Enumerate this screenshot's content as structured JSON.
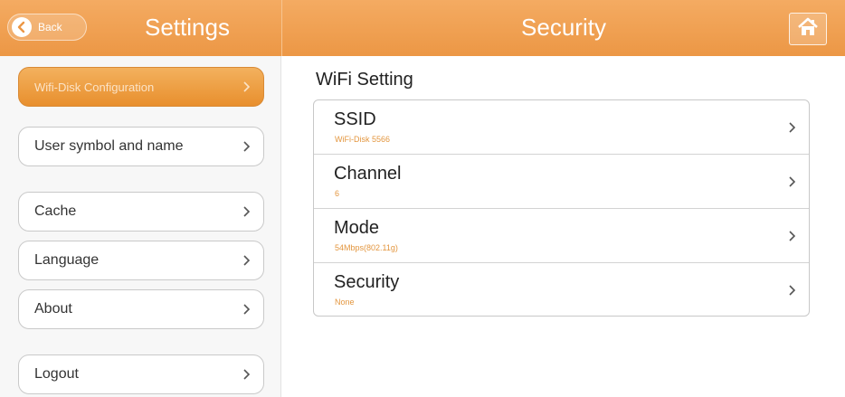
{
  "header": {
    "back_label": "Back",
    "settings_title": "Settings",
    "page_title": "Security",
    "icons": {
      "back": "back-arrow-icon",
      "home": "home-icon"
    }
  },
  "sidebar": {
    "items": [
      {
        "label": "Wifi-Disk Configuration",
        "active": true
      },
      {
        "label": "User symbol and name",
        "active": false
      },
      {
        "label": "Cache",
        "active": false
      },
      {
        "label": "Language",
        "active": false
      },
      {
        "label": "About",
        "active": false
      },
      {
        "label": "Logout",
        "active": false
      }
    ],
    "chevron_icon": "chevron-right-icon"
  },
  "main": {
    "section_title": "WiFi Setting",
    "rows": [
      {
        "label": "SSID",
        "value": "WiFi-Disk 5566"
      },
      {
        "label": "Channel",
        "value": "6"
      },
      {
        "label": "Mode",
        "value": "54Mbps(802.11g)"
      },
      {
        "label": "Security",
        "value": "None"
      }
    ]
  },
  "colors": {
    "accent": "#ec9745",
    "value_text": "#e3963f",
    "active_item": "#e88f2d"
  }
}
